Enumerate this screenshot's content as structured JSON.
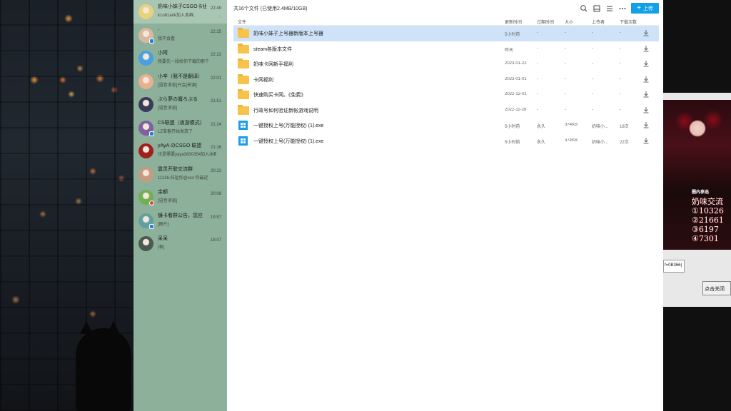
{
  "chats": [
    {
      "name": "奶味小妹子CSGO卡组",
      "time": "22:49",
      "preview": "k1o81ank加入本群,",
      "avatar_color": "#e8d27a",
      "active": true,
      "badge": "",
      "muted": true
    },
    {
      "name": "-",
      "time": "22:25",
      "preview": "我不会看",
      "avatar_color": "#d8b8a0",
      "active": false,
      "badge": "blue",
      "muted": false
    },
    {
      "name": "小阿",
      "time": "22:22",
      "preview": "我要先一段给你下载的那个",
      "avatar_color": "#4aa0e0",
      "active": false,
      "badge": "",
      "muted": false
    },
    {
      "name": "小辛（我不是翻译）",
      "time": "22:01",
      "preview": "[语音消息]只会[来源]",
      "avatar_color": "#e8b090",
      "active": false,
      "badge": "",
      "muted": false
    },
    {
      "name": "ぶら夢の魔ろぶる",
      "time": "21:51",
      "preview": "[语音消息]",
      "avatar_color": "#3a3a5a",
      "active": false,
      "badge": "",
      "muted": false
    },
    {
      "name": "CS联盟（夜游模式）",
      "time": "21:24",
      "preview": "LZ准备开始发放了",
      "avatar_color": "#8060a0",
      "active": false,
      "badge": "blue",
      "muted": false
    },
    {
      "name": "yAyA のCSGO 联盟",
      "time": "21:16",
      "preview": "也是需要yaya3800354加入本群",
      "avatar_color": "#a02020",
      "active": false,
      "badge": "",
      "muted": false
    },
    {
      "name": "震灵开联交流群",
      "time": "20:22",
      "preview": "11126-拉扯你@xxx 你最近",
      "avatar_color": "#c89a80",
      "active": false,
      "badge": "",
      "muted": false
    },
    {
      "name": "余额",
      "time": "20:08",
      "preview": "[语音消息]",
      "avatar_color": "#70b050",
      "active": false,
      "badge": "red",
      "muted": false
    },
    {
      "name": "镰卡看群公告，您应",
      "time": "19:57",
      "preview": "[图片]",
      "avatar_color": "#60a0a0",
      "active": false,
      "badge": "blue",
      "muted": false
    },
    {
      "name": "呆呆",
      "time": "18:07",
      "preview": "[表]",
      "avatar_color": "#4a5a50",
      "active": false,
      "badge": "",
      "muted": false
    }
  ],
  "file_panel": {
    "summary": "共16个文件 (已使用2.4MB/10GB)",
    "upload_label": "上传",
    "columns": {
      "name": "文件",
      "modified": "更新时间",
      "expires": "过期时间",
      "size": "大小",
      "uploader": "上传者",
      "downloads": "下载次数"
    },
    "files": [
      {
        "name": "奶味小妹子上号器新版本上号器",
        "modified": "5小时前",
        "expires": "-",
        "size": "-",
        "uploader": "-",
        "downloads": "-",
        "type": "folder",
        "selected": true
      },
      {
        "name": "steam各版本文件",
        "modified": "昨天",
        "expires": "-",
        "size": "-",
        "uploader": "-",
        "downloads": "-",
        "type": "folder",
        "selected": false
      },
      {
        "name": "奶味卡网新手福利",
        "modified": "2023-01-22",
        "expires": "-",
        "size": "-",
        "uploader": "-",
        "downloads": "-",
        "type": "folder",
        "selected": false
      },
      {
        "name": "卡网福利",
        "modified": "2023-01-01",
        "expires": "-",
        "size": "-",
        "uploader": "-",
        "downloads": "-",
        "type": "folder",
        "selected": false
      },
      {
        "name": "快速购买卡网。《免费》",
        "modified": "2022-12-01",
        "expires": "-",
        "size": "-",
        "uploader": "-",
        "downloads": "-",
        "type": "folder",
        "selected": false
      },
      {
        "name": "行政号如何验证新帐游戏说明",
        "modified": "2022-11-28",
        "expires": "-",
        "size": "-",
        "uploader": "-",
        "downloads": "-",
        "type": "folder",
        "selected": false
      },
      {
        "name": "一键授权上号(万能授权) (1).exe",
        "modified": "5小时前",
        "expires": "永久",
        "size": "374KB",
        "uploader": "奶味小...",
        "downloads": "18次",
        "type": "exe",
        "selected": false
      },
      {
        "name": "一键授权上号(万能授权) (1).exe",
        "modified": "5小时前",
        "expires": "永久",
        "size": "374KB",
        "uploader": "奶味小...",
        "downloads": "22次",
        "type": "exe",
        "selected": false
      }
    ]
  },
  "side_window": {
    "caption": "圈内参选",
    "poster_lines": [
      "奶味交流",
      "①10326",
      "②21661",
      "③6197",
      "④7301"
    ],
    "id_field": "f=0B366(",
    "close_button": "点击关闭"
  },
  "colors": {
    "chat_bg": "#8cb09a",
    "accent": "#12a0e8",
    "selected_row": "#cfe3f8",
    "folder": "#f7c34a"
  }
}
